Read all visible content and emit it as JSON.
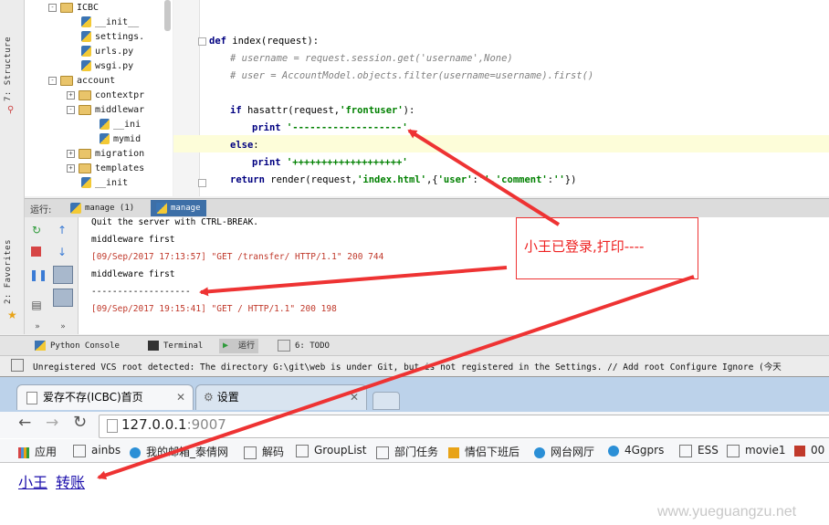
{
  "ide": {
    "side_tabs": {
      "structure": "7: Structure",
      "favorites": "2: Favorites"
    },
    "tree": [
      {
        "label": "ICBC",
        "kind": "folder",
        "toggle": "-",
        "indent": 0
      },
      {
        "label": "__init__",
        "kind": "py",
        "indent": 1
      },
      {
        "label": "settings.",
        "kind": "py",
        "indent": 1
      },
      {
        "label": "urls.py",
        "kind": "py",
        "indent": 1
      },
      {
        "label": "wsgi.py",
        "kind": "py",
        "indent": 1
      },
      {
        "label": "account",
        "kind": "folder",
        "toggle": "-",
        "indent": 0
      },
      {
        "label": "contextpr",
        "kind": "folder",
        "toggle": "+",
        "indent": 1
      },
      {
        "label": "middlewar",
        "kind": "folder",
        "toggle": "-",
        "indent": 1
      },
      {
        "label": "__ini",
        "kind": "py",
        "indent": 2
      },
      {
        "label": "mymid",
        "kind": "py",
        "indent": 2
      },
      {
        "label": "migration",
        "kind": "folder",
        "toggle": "+",
        "indent": 1
      },
      {
        "label": "templates",
        "kind": "folder",
        "toggle": "+",
        "indent": 1
      },
      {
        "label": "__init",
        "kind": "py",
        "indent": 1
      }
    ],
    "code": {
      "line1_kw": "def",
      "line1_rest": " index(request):",
      "line2": "# username = request.session.get('username',None)",
      "line3": "# user = AccountModel.objects.filter(username=username).first()",
      "line4_kw": "if",
      "line4_a": " hasattr(request,",
      "line4_str": "'frontuser'",
      "line4_b": "):",
      "line5_kw": "print",
      "line5_str": " '-------------------'",
      "line6_kw": "else",
      "line6_rest": ":",
      "line7_kw": "print",
      "line7_str": " '+++++++++++++++++++'",
      "line8_kw": "return",
      "line8_a": " render(request,",
      "line8_s1": "'index.html'",
      "line8_b": ",{",
      "line8_s2": "'user'",
      "line8_c": ":",
      "line8_s3": "''",
      "line8_d": ",",
      "line8_s4": "'comment'",
      "line8_e": ":",
      "line8_s5": "''",
      "line8_f": "})"
    },
    "run_panel": {
      "label": "运行:",
      "tabs": [
        "manage (1)",
        "manage"
      ]
    },
    "console": [
      {
        "text": "Quit the server with CTRL-BREAK.",
        "color": "#000000"
      },
      {
        "text": "middleware first",
        "color": "#000000"
      },
      {
        "text": "[09/Sep/2017 17:13:57] \"GET /transfer/ HTTP/1.1\" 200 744",
        "color": "#c0392b"
      },
      {
        "text": "middleware first",
        "color": "#000000"
      },
      {
        "text": "-------------------",
        "color": "#000000"
      },
      {
        "text": "[09/Sep/2017 19:15:41] \"GET / HTTP/1.1\" 200 198",
        "color": "#c0392b"
      }
    ],
    "bottom_tabs": [
      "Python Console",
      "Terminal",
      "运行",
      "6: TODO"
    ],
    "status": "Unregistered VCS root detected: The directory G:\\git\\web is under Git, but is not registered in the Settings. // Add root  Configure  Ignore (今天"
  },
  "browser": {
    "tabs": [
      {
        "title": "爱存不存(ICBC)首页",
        "active": true
      },
      {
        "title": "设置",
        "active": false
      }
    ],
    "url_host": "127.0.0.1",
    "url_port": ":9007",
    "bookmarks": [
      "应用",
      "ainbs",
      "我的邮箱_泰倩网",
      "解码",
      "GroupList",
      "部门任务",
      "情侣下班后",
      "网台网厅",
      "4Ggprs",
      "ESS",
      "movie1",
      "00"
    ],
    "page_links": [
      "小王",
      "转账"
    ]
  },
  "annotation": {
    "text": "小王已登录,打印----",
    "arrow_color": "#ee3333"
  },
  "watermark": "www.yueguangzu.net"
}
